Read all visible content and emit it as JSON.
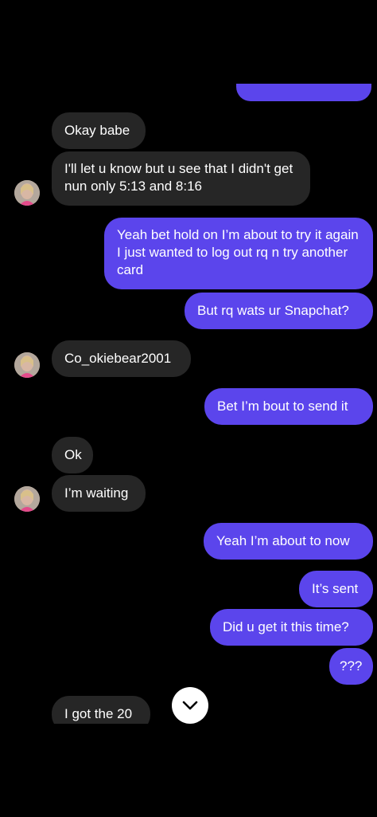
{
  "colors": {
    "background": "#000000",
    "incoming_bubble": "#262626",
    "outgoing_bubble": "#5b45ec",
    "text": "#ffffff",
    "scroll_button": "#ffffff"
  },
  "messages": [
    {
      "from": "them",
      "text": "Okay babe"
    },
    {
      "from": "them",
      "text": "I'll let u know but u see that I didn't get nun only 5:13 and 8:16"
    },
    {
      "from": "me",
      "text": "Yeah bet hold on I’m about to try it again I just wanted to log out rq n try another card"
    },
    {
      "from": "me",
      "text": "But rq wats ur Snapchat?"
    },
    {
      "from": "them",
      "text": "Co_okiebear2001"
    },
    {
      "from": "me",
      "text": "Bet I’m bout to send it"
    },
    {
      "from": "them",
      "text": "Ok"
    },
    {
      "from": "them",
      "text": "I’m waiting"
    },
    {
      "from": "me",
      "text": "Yeah I’m about to now"
    },
    {
      "from": "me",
      "text": "It’s sent"
    },
    {
      "from": "me",
      "text": "Did u get it this time?"
    },
    {
      "from": "me",
      "text": "???"
    },
    {
      "from": "them",
      "text": "I got the 20"
    }
  ],
  "icons": {
    "scroll_down": "chevron-down-icon",
    "avatar": "contact-avatar"
  }
}
